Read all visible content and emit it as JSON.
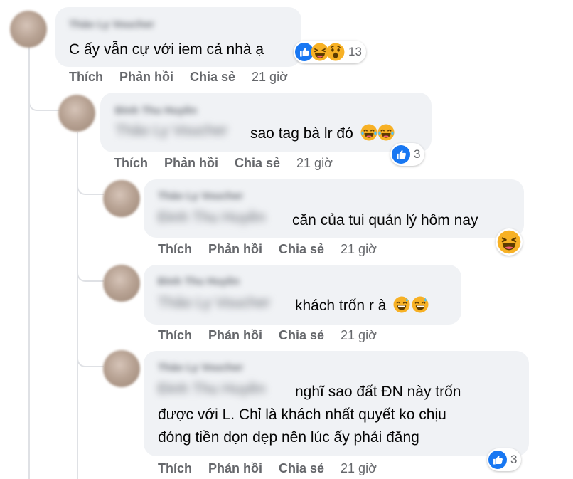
{
  "colors": {
    "bubble": "#f0f2f5",
    "meta": "#65676b",
    "like": "#1877f2",
    "emoji": "#f7b125"
  },
  "comments": [
    {
      "author": "Thảo Ly Voucher",
      "text": "C ấy vẫn cự với iem cả nhà ạ",
      "actions": {
        "like": "Thích",
        "reply": "Phản hồi",
        "share": "Chia sẻ",
        "time": "21 giờ"
      },
      "reactions": {
        "icons": [
          "like-icon",
          "laughing-face-icon",
          "wow-face-icon"
        ],
        "count": "13"
      }
    },
    {
      "author": "Đinh Thu Huyền",
      "tag": "Thảo Ly Voucher",
      "text": "sao tag bà lr đó",
      "actions": {
        "like": "Thích",
        "reply": "Phản hồi",
        "share": "Chia sẻ",
        "time": "21 giờ"
      },
      "reactions": {
        "icons": [
          "like-icon"
        ],
        "count": "3"
      }
    },
    {
      "author": "Thảo Ly Voucher",
      "tag": "Đinh Thu Huyền",
      "text": "căn của tui quản lý hôm nay",
      "actions": {
        "like": "Thích",
        "reply": "Phản hồi",
        "share": "Chia sẻ",
        "time": "21 giờ"
      },
      "reactions": {
        "icons": [
          "laughing-face-icon"
        ],
        "count": ""
      }
    },
    {
      "author": "Đinh Thu Huyền",
      "tag": "Thảo Ly Voucher",
      "text": "khách trốn r à",
      "actions": {
        "like": "Thích",
        "reply": "Phản hồi",
        "share": "Chia sẻ",
        "time": "21 giờ"
      },
      "reactions": {
        "icons": [],
        "count": ""
      }
    },
    {
      "author": "Thảo Ly Voucher",
      "tag": "Đinh Thu Huyền",
      "text_lines": [
        "nghĩ sao đất ĐN này trốn",
        "được với L. Chỉ là khách nhất quyết ko chịu",
        "đóng tiền dọn dẹp nên lúc ấy phải đăng"
      ],
      "actions": {
        "like": "Thích",
        "reply": "Phản hồi",
        "share": "Chia sẻ",
        "time": "21 giờ"
      },
      "reactions": {
        "icons": [
          "like-icon"
        ],
        "count": "3"
      }
    }
  ]
}
